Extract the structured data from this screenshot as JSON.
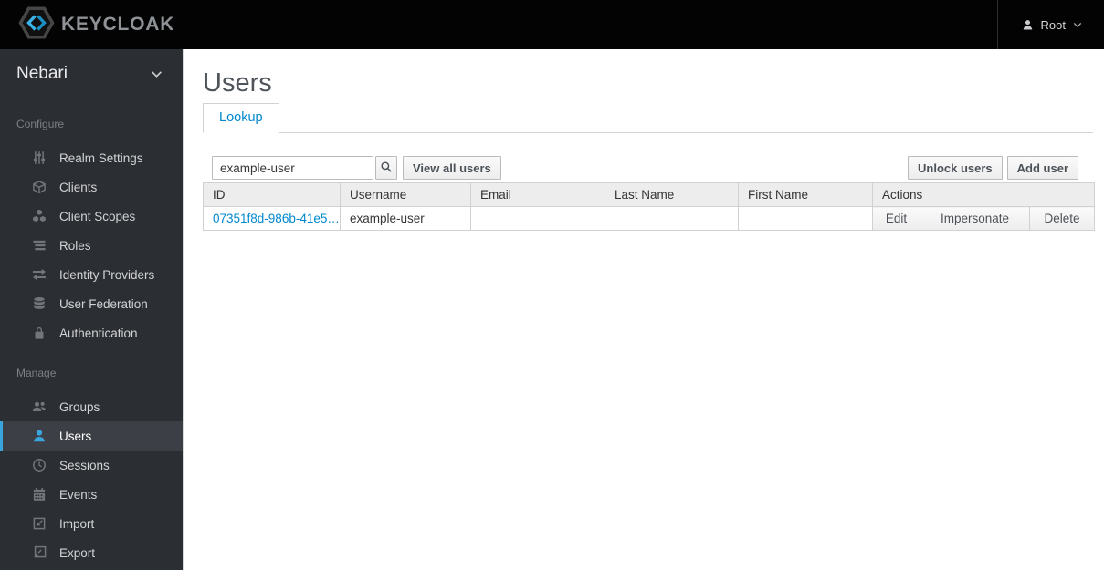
{
  "topbar": {
    "brand": "KEYCLOAK",
    "user_label": "Root"
  },
  "sidebar": {
    "realm": "Nebari",
    "sections": [
      {
        "label": "Configure",
        "items": [
          {
            "label": "Realm Settings",
            "icon": "sliders-icon"
          },
          {
            "label": "Clients",
            "icon": "cube-icon"
          },
          {
            "label": "Client Scopes",
            "icon": "cubes-icon"
          },
          {
            "label": "Roles",
            "icon": "list-icon"
          },
          {
            "label": "Identity Providers",
            "icon": "exchange-arrows-icon"
          },
          {
            "label": "User Federation",
            "icon": "database-icon"
          },
          {
            "label": "Authentication",
            "icon": "lock-icon"
          }
        ]
      },
      {
        "label": "Manage",
        "items": [
          {
            "label": "Groups",
            "icon": "group-icon"
          },
          {
            "label": "Users",
            "icon": "user-icon",
            "active": true
          },
          {
            "label": "Sessions",
            "icon": "clock-icon"
          },
          {
            "label": "Events",
            "icon": "calendar-icon"
          },
          {
            "label": "Import",
            "icon": "import-icon"
          },
          {
            "label": "Export",
            "icon": "export-icon"
          }
        ]
      }
    ]
  },
  "main": {
    "title": "Users",
    "tabs": [
      {
        "label": "Lookup",
        "active": true
      }
    ],
    "toolbar": {
      "search_value": "example-user",
      "search_icon": "search-icon",
      "view_all_label": "View all users",
      "unlock_label": "Unlock users",
      "add_label": "Add user"
    },
    "table": {
      "columns": [
        "ID",
        "Username",
        "Email",
        "Last Name",
        "First Name",
        "Actions"
      ],
      "rows": [
        {
          "id": "07351f8d-986b-41e5…",
          "username": "example-user",
          "email": "",
          "last_name": "",
          "first_name": "",
          "actions": [
            "Edit",
            "Impersonate",
            "Delete"
          ]
        }
      ]
    }
  },
  "colors": {
    "topbar_bg": "#030303",
    "sidebar_bg": "#2b2e33",
    "active_item_bg": "#3c4046",
    "accent_blue": "#39a5dc",
    "link_blue": "#0088ce"
  }
}
